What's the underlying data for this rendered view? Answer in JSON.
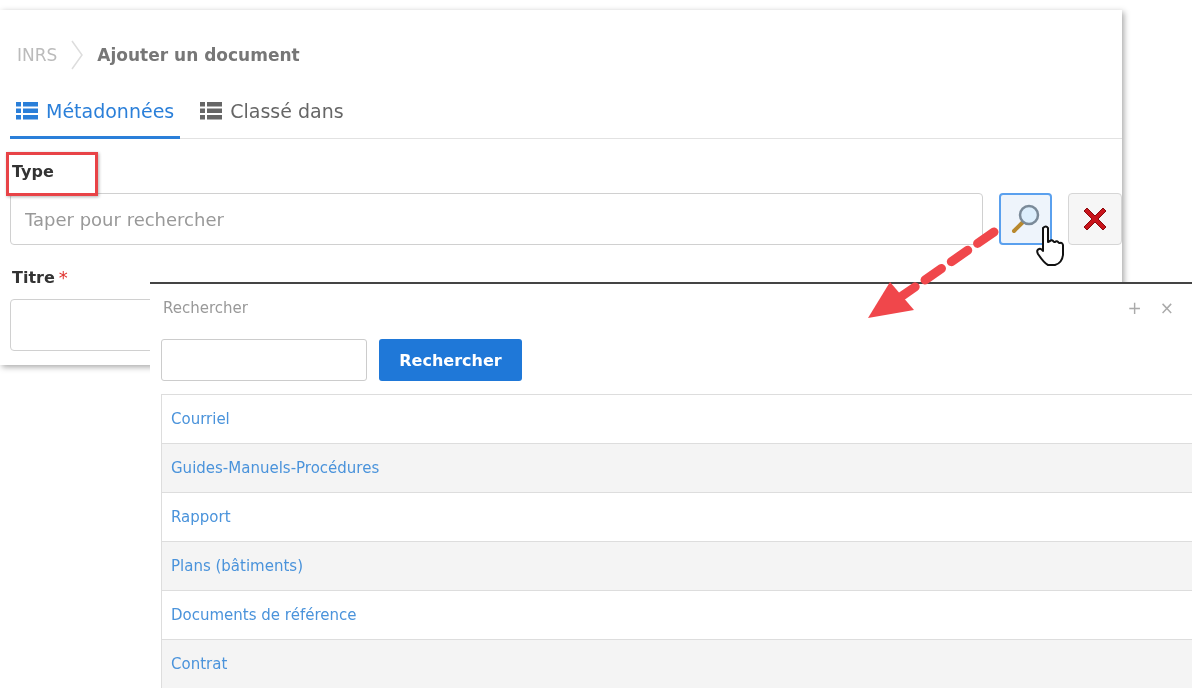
{
  "breadcrumb": {
    "root": "INRS",
    "current": "Ajouter un document"
  },
  "tabs": [
    {
      "label": "Métadonnées",
      "selected": true
    },
    {
      "label": "Classé dans",
      "selected": false
    }
  ],
  "fields": [
    {
      "label": "Type",
      "placeholder": "Taper pour rechercher",
      "kind": "lookup",
      "highlighted": true
    },
    {
      "label": "Titre",
      "required_mark": "*",
      "kind": "text"
    }
  ],
  "dialog": {
    "title": "Rechercher",
    "add_icon": "+",
    "close_icon": "×",
    "search_button": "Rechercher",
    "results": [
      {
        "label": "Courriel"
      },
      {
        "label": "Guides-Manuels-Procédures"
      },
      {
        "label": "Rapport"
      },
      {
        "label": "Plans (bâtiments)"
      },
      {
        "label": "Documents de référence"
      },
      {
        "label": "Contrat"
      }
    ]
  }
}
